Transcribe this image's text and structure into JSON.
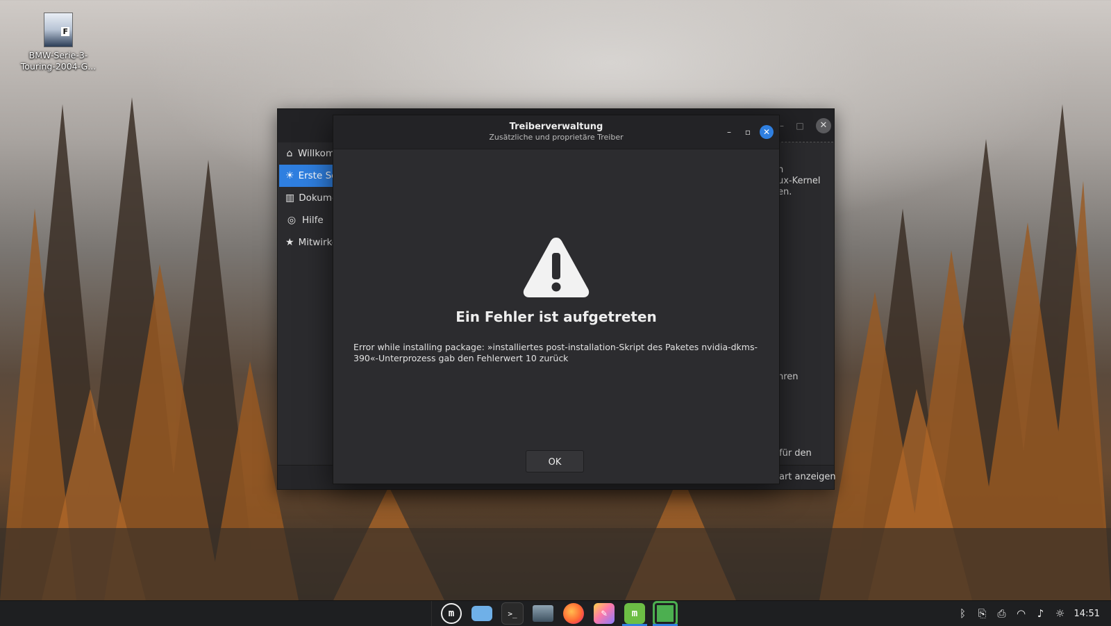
{
  "desktop": {
    "icon_label": "BMW-Serie-3-Touring-2004-G..."
  },
  "welcome_window": {
    "sidebar": [
      {
        "label": "Willkom",
        "icon": "home-icon",
        "active": false
      },
      {
        "label": "Erste Sc",
        "icon": "lightbulb-icon",
        "active": true
      },
      {
        "label": "Dokume",
        "icon": "book-icon",
        "active": false
      },
      {
        "label": "Hilfe",
        "icon": "lifebuoy-icon",
        "active": false
      },
      {
        "label": "Mitwirke",
        "icon": "star-icon",
        "active": false
      }
    ],
    "text_fragments": [
      "n",
      "ux-Kernel",
      "en.",
      "hren",
      "für den",
      "art anzeigen"
    ]
  },
  "dialog": {
    "title": "Treiberverwaltung",
    "subtitle": "Zusätzliche und proprietäre Treiber",
    "heading": "Ein Fehler ist aufgetreten",
    "message": "Error while installing package: »installiertes post-installation-Skript des Paketes nvidia-dkms-390«-Unterprozess gab den Fehlerwert 10 zurück",
    "ok_label": "OK"
  },
  "taskbar": {
    "apps": [
      {
        "name": "mint-menu-icon",
        "glyph": "m",
        "bg": "#1e1f21",
        "active": false
      },
      {
        "name": "files-icon",
        "glyph": "",
        "bg": "#6fb0e8",
        "active": false
      },
      {
        "name": "terminal-icon",
        "glyph": ">_",
        "bg": "#2a2a2a",
        "active": false
      },
      {
        "name": "desktop-icon",
        "glyph": "",
        "bg": "#546a7b",
        "active": false
      },
      {
        "name": "firefox-icon",
        "glyph": "",
        "bg": "#ff6a33",
        "active": false
      },
      {
        "name": "paint-icon",
        "glyph": "",
        "bg": "#c07be0",
        "active": false
      },
      {
        "name": "mint-welcome-icon",
        "glyph": "m",
        "bg": "#6cbe45",
        "active": true
      },
      {
        "name": "driver-manager-icon",
        "glyph": "",
        "bg": "#4caf50",
        "active": true
      }
    ],
    "clock": "14:51"
  }
}
